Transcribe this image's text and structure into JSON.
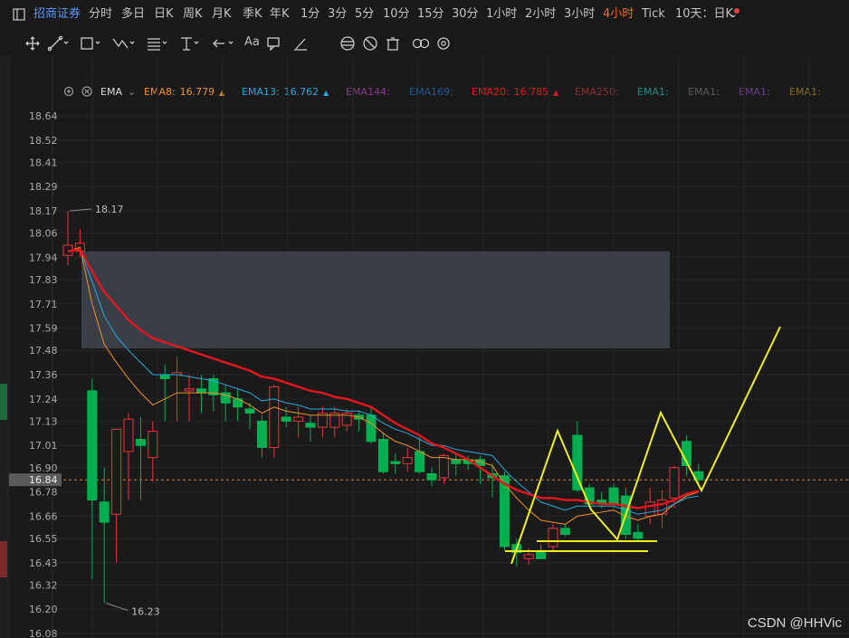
{
  "toolbar": {
    "brand": "招商证券",
    "tabs": [
      "分时",
      "多日",
      "日K",
      "周K",
      "月K",
      "季K",
      "年K",
      "1分",
      "3分",
      "5分",
      "10分",
      "15分",
      "30分",
      "1小时",
      "2小时",
      "3小时",
      "4小时",
      "Tick",
      "10天：日K"
    ],
    "active_tab": "4小时",
    "font_size_icon_label": "Aa",
    "icons": [
      "panel-icon",
      "crosshair-icon",
      "line-tool-icon",
      "rect-tool-icon",
      "path-tool-icon",
      "fib-tool-icon",
      "measure-tool-icon",
      "arrow-tool-icon",
      "comment-icon",
      "pencil-icon",
      "magnet-icon",
      "eye-off-icon",
      "trash-icon",
      "link-icon",
      "settings-icon"
    ]
  },
  "indicator_bar": {
    "name": "EMA",
    "items": [
      {
        "label": "EMA8:",
        "value": "16.779",
        "color": "#f0912a",
        "arrow": "▲"
      },
      {
        "label": "EMA13:",
        "value": "16.762",
        "color": "#27a8e0",
        "arrow": "▲"
      },
      {
        "label": "EMA144:",
        "value": "",
        "color": "#8a3a8a",
        "arrow": ""
      },
      {
        "label": "EMA169:",
        "value": "",
        "color": "#1f5a9a",
        "arrow": ""
      },
      {
        "label": "EMA20:",
        "value": "16.785",
        "color": "#e8151d",
        "arrow": "▲"
      },
      {
        "label": "EMA250:",
        "value": "",
        "color": "#8a3030",
        "arrow": ""
      },
      {
        "label": "EMA1:",
        "value": "",
        "color": "#1e8a8a",
        "arrow": ""
      },
      {
        "label": "EMA1:",
        "value": "",
        "color": "#5a5a5a",
        "arrow": ""
      },
      {
        "label": "EMA1:",
        "value": "",
        "color": "#6a3a8a",
        "arrow": ""
      },
      {
        "label": "EMA1:",
        "value": "",
        "color": "#8a6a20",
        "arrow": ""
      }
    ]
  },
  "watermark": "CSDN @HHVic",
  "chart_data": {
    "type": "candlestick",
    "y_axis_ticks": [
      18.64,
      18.52,
      18.41,
      18.29,
      18.17,
      18.06,
      17.94,
      17.83,
      17.71,
      17.59,
      17.48,
      17.36,
      17.24,
      17.13,
      17.01,
      16.9,
      16.78,
      16.66,
      16.55,
      16.43,
      16.32,
      16.2,
      16.08
    ],
    "ylim": [
      16.08,
      18.64
    ],
    "current_price": "16.84",
    "high_label": "18.17",
    "low_label": "16.23",
    "grid": true,
    "colors": {
      "up": "#e8333a",
      "down": "#00b050",
      "ema8": "#f0912a",
      "ema13": "#27a8e0",
      "ema20": "#e8151d",
      "drawing": "#f0f020",
      "zone": "#3a3f47"
    },
    "candles": [
      {
        "o": 17.95,
        "h": 18.17,
        "l": 17.9,
        "c": 18.0
      },
      {
        "o": 17.97,
        "h": 18.08,
        "l": 17.94,
        "c": 18.01
      },
      {
        "o": 17.28,
        "h": 17.34,
        "l": 16.35,
        "c": 16.74
      },
      {
        "o": 16.73,
        "h": 16.9,
        "l": 16.23,
        "c": 16.63
      },
      {
        "o": 16.67,
        "h": 17.09,
        "l": 16.43,
        "c": 17.09
      },
      {
        "o": 16.98,
        "h": 17.17,
        "l": 16.74,
        "c": 17.14
      },
      {
        "o": 17.04,
        "h": 17.15,
        "l": 16.74,
        "c": 17.01
      },
      {
        "o": 16.95,
        "h": 17.13,
        "l": 16.83,
        "c": 17.08
      },
      {
        "o": 17.36,
        "h": 17.41,
        "l": 17.13,
        "c": 17.34
      },
      {
        "o": 17.36,
        "h": 17.45,
        "l": 17.13,
        "c": 17.37
      },
      {
        "o": 17.28,
        "h": 17.36,
        "l": 17.13,
        "c": 17.29
      },
      {
        "o": 17.29,
        "h": 17.36,
        "l": 17.17,
        "c": 17.27
      },
      {
        "o": 17.34,
        "h": 17.36,
        "l": 17.18,
        "c": 17.26
      },
      {
        "o": 17.27,
        "h": 17.31,
        "l": 17.13,
        "c": 17.22
      },
      {
        "o": 17.24,
        "h": 17.29,
        "l": 17.13,
        "c": 17.2
      },
      {
        "o": 17.19,
        "h": 17.22,
        "l": 17.09,
        "c": 17.17
      },
      {
        "o": 17.13,
        "h": 17.16,
        "l": 16.95,
        "c": 17.0
      },
      {
        "o": 17.0,
        "h": 17.31,
        "l": 16.95,
        "c": 17.3
      },
      {
        "o": 17.15,
        "h": 17.2,
        "l": 17.1,
        "c": 17.13
      },
      {
        "o": 17.13,
        "h": 17.2,
        "l": 17.05,
        "c": 17.15
      },
      {
        "o": 17.12,
        "h": 17.16,
        "l": 17.03,
        "c": 17.1
      },
      {
        "o": 17.1,
        "h": 17.2,
        "l": 17.05,
        "c": 17.17
      },
      {
        "o": 17.1,
        "h": 17.2,
        "l": 17.05,
        "c": 17.17
      },
      {
        "o": 17.11,
        "h": 17.19,
        "l": 17.08,
        "c": 17.17
      },
      {
        "o": 17.16,
        "h": 17.18,
        "l": 17.08,
        "c": 17.14
      },
      {
        "o": 17.16,
        "h": 17.2,
        "l": 17.02,
        "c": 17.03
      },
      {
        "o": 17.04,
        "h": 17.07,
        "l": 16.87,
        "c": 16.88
      },
      {
        "o": 16.93,
        "h": 16.97,
        "l": 16.87,
        "c": 16.92
      },
      {
        "o": 16.92,
        "h": 17.0,
        "l": 16.88,
        "c": 16.95
      },
      {
        "o": 16.98,
        "h": 17.05,
        "l": 16.87,
        "c": 16.88
      },
      {
        "o": 16.87,
        "h": 16.9,
        "l": 16.81,
        "c": 16.84
      },
      {
        "o": 16.85,
        "h": 16.97,
        "l": 16.82,
        "c": 16.96
      },
      {
        "o": 16.94,
        "h": 16.97,
        "l": 16.86,
        "c": 16.92
      },
      {
        "o": 16.94,
        "h": 16.96,
        "l": 16.89,
        "c": 16.92
      },
      {
        "o": 16.94,
        "h": 16.96,
        "l": 16.82,
        "c": 16.91
      },
      {
        "o": 16.87,
        "h": 16.92,
        "l": 16.75,
        "c": 16.85
      },
      {
        "o": 16.86,
        "h": 16.88,
        "l": 16.49,
        "c": 16.51
      },
      {
        "o": 16.52,
        "h": 16.55,
        "l": 16.41,
        "c": 16.48
      },
      {
        "o": 16.45,
        "h": 16.5,
        "l": 16.42,
        "c": 16.47
      },
      {
        "o": 16.49,
        "h": 16.52,
        "l": 16.45,
        "c": 16.45
      },
      {
        "o": 16.51,
        "h": 16.62,
        "l": 16.48,
        "c": 16.6
      },
      {
        "o": 16.6,
        "h": 16.62,
        "l": 16.56,
        "c": 16.57
      },
      {
        "o": 17.06,
        "h": 17.13,
        "l": 16.78,
        "c": 16.79
      },
      {
        "o": 16.8,
        "h": 16.82,
        "l": 16.7,
        "c": 16.72
      },
      {
        "o": 16.74,
        "h": 16.78,
        "l": 16.7,
        "c": 16.72
      },
      {
        "o": 16.8,
        "h": 16.82,
        "l": 16.7,
        "c": 16.72
      },
      {
        "o": 16.76,
        "h": 16.8,
        "l": 16.55,
        "c": 16.57
      },
      {
        "o": 16.58,
        "h": 16.62,
        "l": 16.54,
        "c": 16.55
      },
      {
        "o": 16.66,
        "h": 16.8,
        "l": 16.62,
        "c": 16.73
      },
      {
        "o": 16.67,
        "h": 16.79,
        "l": 16.6,
        "c": 16.74
      },
      {
        "o": 16.75,
        "h": 16.91,
        "l": 16.7,
        "c": 16.9
      },
      {
        "o": 17.03,
        "h": 17.06,
        "l": 16.86,
        "c": 16.91
      },
      {
        "o": 16.88,
        "h": 16.92,
        "l": 16.82,
        "c": 16.84
      }
    ],
    "ema8": [
      17.97,
      17.99,
      17.71,
      17.51,
      17.42,
      17.34,
      17.27,
      17.21,
      17.24,
      17.27,
      17.27,
      17.27,
      17.27,
      17.26,
      17.24,
      17.21,
      17.17,
      17.2,
      17.18,
      17.17,
      17.16,
      17.16,
      17.16,
      17.16,
      17.15,
      17.12,
      17.07,
      17.03,
      17.01,
      16.98,
      16.95,
      16.95,
      16.94,
      16.94,
      16.93,
      16.91,
      16.82,
      16.75,
      16.69,
      16.64,
      16.63,
      16.62,
      16.66,
      16.67,
      16.68,
      16.69,
      16.66,
      16.64,
      16.66,
      16.67,
      16.72,
      16.76,
      16.78
    ],
    "ema13": [
      17.97,
      17.98,
      17.82,
      17.65,
      17.55,
      17.48,
      17.42,
      17.36,
      17.36,
      17.36,
      17.35,
      17.34,
      17.33,
      17.31,
      17.29,
      17.27,
      17.23,
      17.24,
      17.22,
      17.21,
      17.19,
      17.19,
      17.19,
      17.18,
      17.18,
      17.16,
      17.12,
      17.09,
      17.07,
      17.04,
      17.01,
      17.01,
      16.99,
      16.98,
      16.97,
      16.96,
      16.89,
      16.83,
      16.78,
      16.73,
      16.71,
      16.69,
      16.71,
      16.71,
      16.71,
      16.71,
      16.69,
      16.67,
      16.68,
      16.69,
      16.72,
      16.75,
      16.76
    ],
    "ema20": [
      17.97,
      17.98,
      17.87,
      17.77,
      17.7,
      17.63,
      17.58,
      17.54,
      17.52,
      17.5,
      17.48,
      17.46,
      17.44,
      17.42,
      17.4,
      17.38,
      17.35,
      17.34,
      17.32,
      17.3,
      17.28,
      17.27,
      17.25,
      17.24,
      17.22,
      17.2,
      17.16,
      17.12,
      17.09,
      17.06,
      17.02,
      17.0,
      16.97,
      16.94,
      16.9,
      16.86,
      16.82,
      16.79,
      16.77,
      16.75,
      16.75,
      16.74,
      16.74,
      16.73,
      16.72,
      16.72,
      16.71,
      16.7,
      16.71,
      16.72,
      16.74,
      16.77,
      16.785
    ]
  }
}
